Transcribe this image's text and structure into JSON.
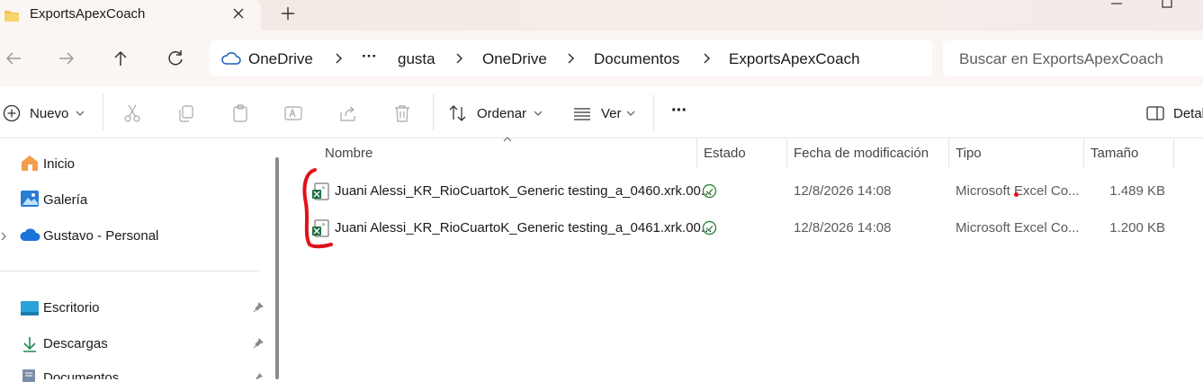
{
  "window": {
    "tab_title": "ExportsApexCoach",
    "close_glyph": "✕",
    "new_tab_glyph": "+"
  },
  "address": {
    "breadcrumbs": [
      "OneDrive",
      "gusta",
      "OneDrive",
      "Documentos",
      "ExportsApexCoach"
    ],
    "overflow_glyph": "···",
    "search_placeholder": "Buscar en ExportsApexCoach"
  },
  "toolbar": {
    "new_label": "Nuevo",
    "sort_label": "Ordenar",
    "view_label": "Ver",
    "more_glyph": "···",
    "details_label": "Detal"
  },
  "sidebar": {
    "items": [
      {
        "label": "Inicio",
        "icon": "home-icon"
      },
      {
        "label": "Galería",
        "icon": "gallery-icon"
      },
      {
        "label": "Gustavo - Personal",
        "icon": "onedrive-cloud-icon"
      }
    ],
    "pinned": [
      {
        "label": "Escritorio",
        "icon": "desktop-icon"
      },
      {
        "label": "Descargas",
        "icon": "download-icon"
      },
      {
        "label": "Documentos",
        "icon": "documents-icon"
      }
    ]
  },
  "columns": {
    "name": "Nombre",
    "status": "Estado",
    "modified": "Fecha de modificación",
    "type": "Tipo",
    "size": "Tamaño"
  },
  "files": [
    {
      "name": "Juani Alessi_KR_RioCuartoK_Generic testing_a_0460.xrk.00...",
      "status": "synced",
      "modified": "12/8/2026 14:08",
      "type": "Microsoft Excel Co...",
      "size": "1.489 KB"
    },
    {
      "name": "Juani Alessi_KR_RioCuartoK_Generic testing_a_0461.xrk.00...",
      "status": "synced",
      "modified": "12/8/2026 14:08",
      "type": "Microsoft Excel Co...",
      "size": "1.200 KB"
    }
  ],
  "colors": {
    "accent": "#0067c0",
    "sync_green": "#3a8a3f",
    "excel_green": "#1d6f42",
    "annotation_red": "#e0101a"
  }
}
